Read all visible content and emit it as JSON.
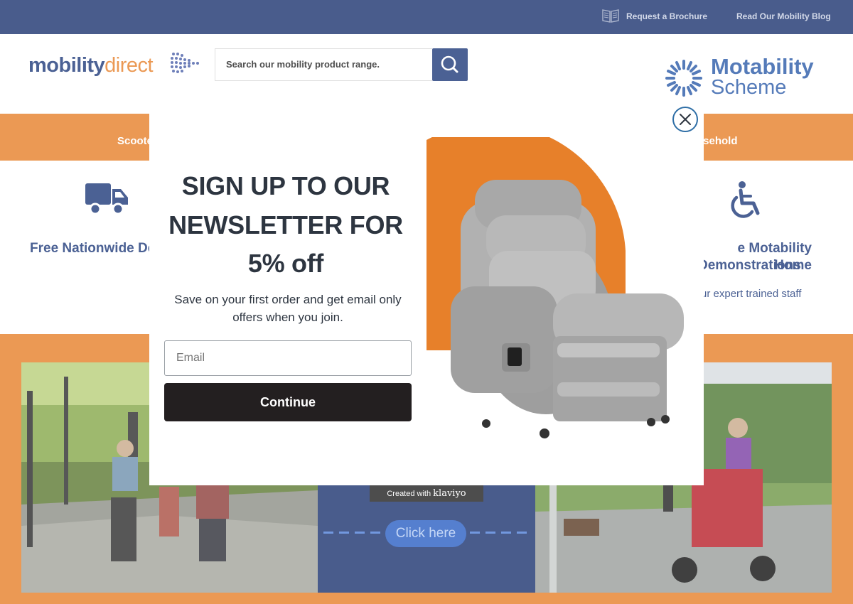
{
  "topbar": {
    "brochure_label": "Request a Brochure",
    "blog_label": "Read Our Mobility Blog"
  },
  "header": {
    "logo_part1": "mobility",
    "logo_part2": "direct",
    "search_placeholder": "Search our mobility product range.",
    "motability_name": "Motability",
    "motability_sub": "Scheme"
  },
  "nav": {
    "items": [
      {
        "label": "Scooters"
      },
      {
        "label": "Household"
      }
    ]
  },
  "features": {
    "delivery_title": "Free Nationwide De",
    "demo_title_line1": "e Motability Home",
    "demo_title_line2": "Demonstrations",
    "demo_sub": "ur expert trained staff"
  },
  "promo": {
    "click_here": "Click here"
  },
  "modal": {
    "headline_line1": "SIGN UP TO OUR",
    "headline_line2": "NEWSLETTER FOR",
    "headline_line3": "5% off",
    "body_text": "Save on your first order and get email only offers when you join.",
    "email_placeholder": "Email",
    "continue_label": "Continue",
    "created_with": "Created with",
    "created_brand": "klaviyo"
  },
  "colors": {
    "navy": "#1c3470",
    "orange": "#e7802a",
    "blue": "#2b5aa8",
    "dark_button": "#231f20"
  },
  "icons": [
    "brochure-icon",
    "search-icon",
    "truck-icon",
    "wheelchair-icon",
    "close-icon"
  ]
}
